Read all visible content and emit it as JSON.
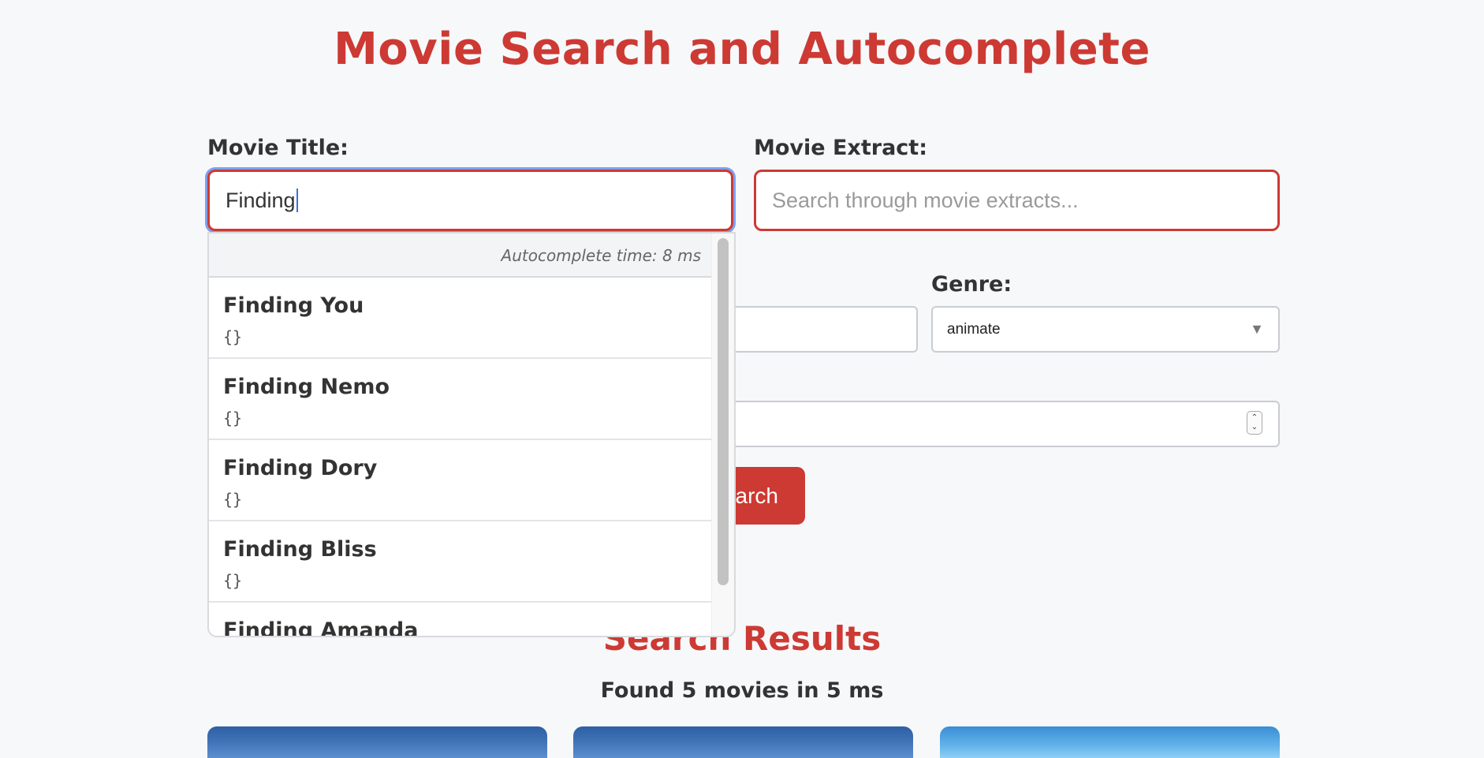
{
  "page": {
    "title": "Movie Search and Autocomplete"
  },
  "form": {
    "title_label": "Movie Title:",
    "title_value": "Finding",
    "extract_label": "Movie Extract:",
    "extract_placeholder": "Search through movie extracts...",
    "genre_label": "Genre:",
    "genre_value": "animate",
    "search_button_label": "arch"
  },
  "autocomplete": {
    "time_text": "Autocomplete time: 8 ms",
    "items": [
      {
        "title": "Finding You",
        "meta": "{}"
      },
      {
        "title": "Finding Nemo",
        "meta": "{}"
      },
      {
        "title": "Finding Dory",
        "meta": "{}"
      },
      {
        "title": "Finding Bliss",
        "meta": "{}"
      },
      {
        "title": "Finding Amanda",
        "meta": ""
      }
    ]
  },
  "results": {
    "heading": "Search Results",
    "count_text": "Found 5 movies in 5 ms"
  },
  "colors": {
    "accent": "#cc3a33",
    "focus_ring": "#7ea0f0"
  }
}
